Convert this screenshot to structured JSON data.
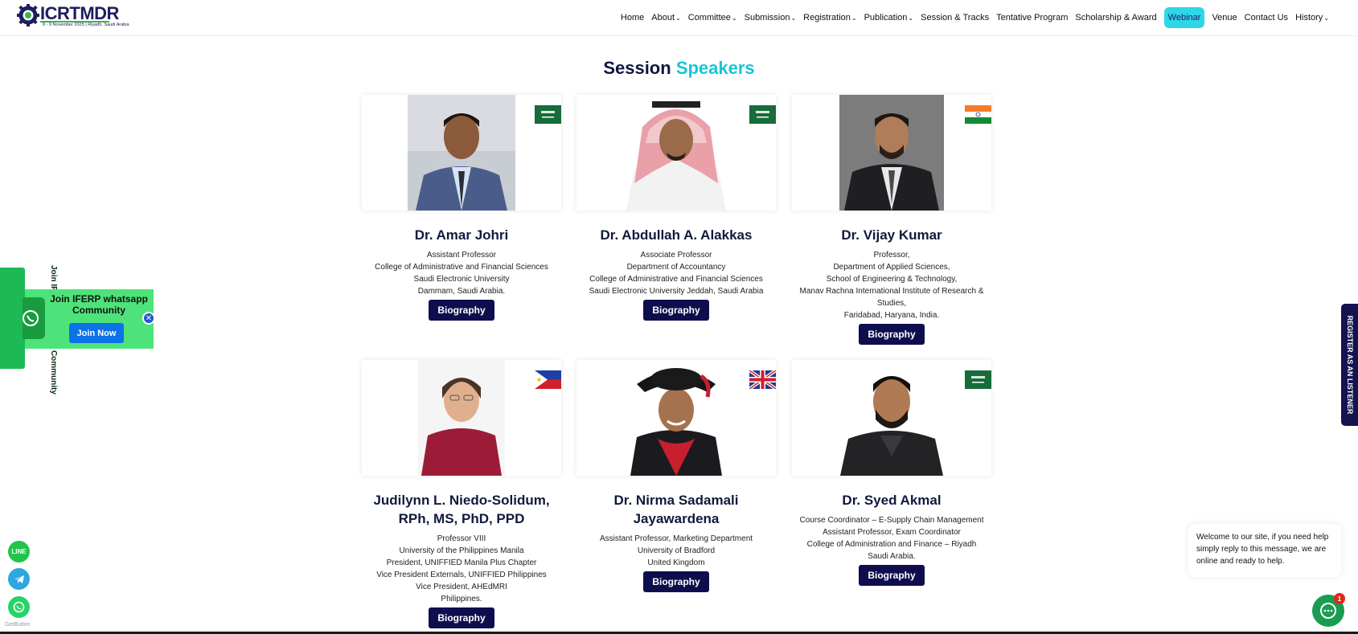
{
  "header": {
    "logo_text": "ICRTMDR",
    "logo_sub": "8 - 9 November 2025 | Riyadh, Saudi Arabia",
    "nav": [
      {
        "label": "Home",
        "dropdown": false
      },
      {
        "label": "About",
        "dropdown": true
      },
      {
        "label": "Committee",
        "dropdown": true
      },
      {
        "label": "Submission",
        "dropdown": true
      },
      {
        "label": "Registration",
        "dropdown": true
      },
      {
        "label": "Publication",
        "dropdown": true
      },
      {
        "label": "Session & Tracks",
        "dropdown": false
      },
      {
        "label": "Tentative Program",
        "dropdown": false
      },
      {
        "label": "Scholarship & Award",
        "dropdown": false
      },
      {
        "label": "Webinar",
        "dropdown": false,
        "active": true
      },
      {
        "label": "Venue",
        "dropdown": false
      },
      {
        "label": "Contact Us",
        "dropdown": false
      },
      {
        "label": "History",
        "dropdown": true
      }
    ]
  },
  "section": {
    "title_main": "Session",
    "title_accent": "Speakers"
  },
  "speakers": [
    {
      "name": "Dr. Amar Johri",
      "flag": "saudi-arabia",
      "lines": [
        "Assistant Professor",
        "College of Administrative and Financial Sciences",
        "Saudi Electronic University",
        "Dammam, Saudi Arabia."
      ],
      "button": "Biography"
    },
    {
      "name": "Dr. Abdullah A. Alakkas",
      "flag": "saudi-arabia",
      "lines": [
        "Associate Professor",
        "Department of Accountancy",
        "College of Administrative and Financial Sciences",
        "Saudi Electronic University Jeddah, Saudi Arabia"
      ],
      "button": "Biography"
    },
    {
      "name": "Dr. Vijay Kumar",
      "flag": "india",
      "lines": [
        "Professor,",
        "Department of Applied Sciences,",
        "School of Engineering & Technology,",
        "Manav Rachna International Institute of Research & Studies,",
        "Faridabad, Haryana, India."
      ],
      "button": "Biography"
    },
    {
      "name": "Judilynn L. Niedo-Solidum, RPh, MS, PhD, PPD",
      "flag": "philippines",
      "lines": [
        "Professor VIII",
        "University of the Philippines Manila",
        "President, UNIFFIED Manila Plus Chapter",
        "Vice President Externals, UNIFFIED Philippines",
        "Vice President, AHEdMRI",
        "Philippines."
      ],
      "button": "Biography"
    },
    {
      "name": "Dr. Nirma Sadamali Jayawardena",
      "flag": "united-kingdom",
      "lines": [
        "Assistant Professor, Marketing Department",
        "University of Bradford",
        "United Kingdom"
      ],
      "button": "Biography"
    },
    {
      "name": "Dr. Syed Akmal",
      "flag": "saudi-arabia",
      "lines": [
        "Course Coordinator – E-Supply Chain Management",
        "Assistant Professor, Exam Coordinator",
        "College of Administration and Finance – Riyadh",
        "Saudi Arabia."
      ],
      "button": "Biography"
    }
  ],
  "whatsapp": {
    "side_label": "Join IFERP Whatsapp Community",
    "popup_title": "Join IFERP whatsapp Community",
    "popup_button": "Join Now",
    "close": "✕"
  },
  "social": {
    "line_label": "LINE",
    "getbutton": "GetButton"
  },
  "register_tab": "REGISTER AS AN LISTENER",
  "chat": {
    "message": "Welcome to our site, if you need help simply reply to this message, we are online and ready to help.",
    "badge": "1"
  },
  "colors": {
    "navy": "#0e0e4e",
    "accent": "#16c5d8",
    "whatsapp_green": "#4ee37a"
  }
}
